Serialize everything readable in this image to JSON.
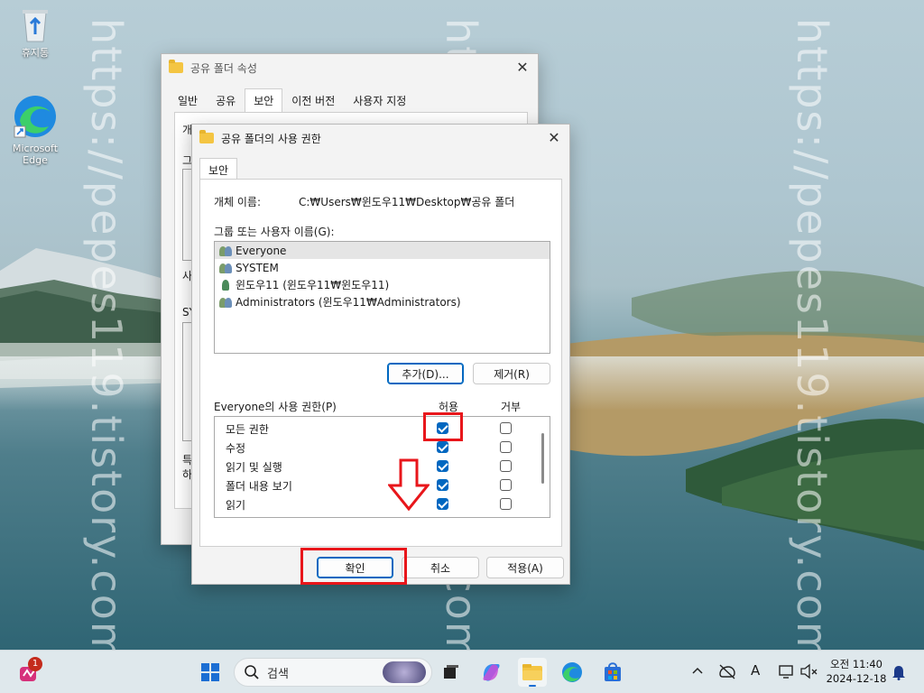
{
  "desktop": {
    "watermark_text": "https://pepes119.tistory.com/",
    "icons": [
      {
        "label": "휴지통",
        "icon": "recycle-bin-icon"
      },
      {
        "label": "Microsoft Edge",
        "icon": "edge-icon"
      }
    ]
  },
  "back_window": {
    "title": "공유 폴더 속성",
    "tabs": [
      "일반",
      "공유",
      "보안",
      "이전 버전",
      "사용자 지정"
    ],
    "active_tab": "보안",
    "partial_texts": [
      "개체 이름:",
      "그",
      "사",
      "SY",
      "특",
      "하"
    ]
  },
  "dialog": {
    "title": "공유 폴더의 사용 권한",
    "tab": "보안",
    "object_name_label": "개체 이름:",
    "object_name_value": "C:₩Users₩윈도우11₩Desktop₩공유 폴더",
    "groups_label": "그룹 또는 사용자 이름(G):",
    "users": [
      {
        "name": "Everyone",
        "selected": true
      },
      {
        "name": "SYSTEM",
        "selected": false
      },
      {
        "name": "윈도우11 (윈도우11₩윈도우11)",
        "selected": false
      },
      {
        "name": "Administrators (윈도우11₩Administrators)",
        "selected": false
      }
    ],
    "add_button": "추가(D)...",
    "remove_button": "제거(R)",
    "permissions_label": "Everyone의 사용 권한(P)",
    "allow_header": "허용",
    "deny_header": "거부",
    "permissions": [
      {
        "name": "모든 권한",
        "allow": true,
        "deny": false
      },
      {
        "name": "수정",
        "allow": true,
        "deny": false
      },
      {
        "name": "읽기 및 실행",
        "allow": true,
        "deny": false
      },
      {
        "name": "폴더 내용 보기",
        "allow": true,
        "deny": false
      },
      {
        "name": "읽기",
        "allow": true,
        "deny": false
      }
    ],
    "ok_button": "확인",
    "cancel_button": "취소",
    "apply_button": "적용(A)"
  },
  "annotations": {
    "highlight_color": "#e8161b",
    "arrow_direction": "down"
  },
  "taskbar": {
    "search_placeholder": "검색",
    "notification_badge": "1",
    "clock_period_time": "오전 11:40",
    "clock_date": "2024-12-18",
    "pinned_icons": [
      "start-icon",
      "task-view-icon",
      "copilot-icon",
      "file-explorer-icon",
      "edge-icon",
      "store-icon"
    ],
    "tray_icons": [
      "chevron-up-icon",
      "network-off-icon",
      "ime-icon",
      "display-icon",
      "volume-mute-icon",
      "notification-bell-icon"
    ],
    "ime_text": "A"
  }
}
